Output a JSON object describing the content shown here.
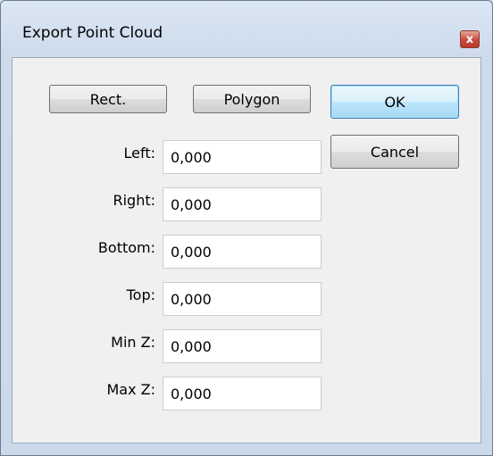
{
  "window": {
    "title": "Export Point Cloud",
    "close_symbol": "x"
  },
  "buttons": {
    "rect": "Rect.",
    "polygon": "Polygon",
    "ok": "OK",
    "cancel": "Cancel"
  },
  "fields": [
    {
      "label": "Left:",
      "value": "0,000"
    },
    {
      "label": "Right:",
      "value": "0,000"
    },
    {
      "label": "Bottom:",
      "value": "0,000"
    },
    {
      "label": "Top:",
      "value": "0,000"
    },
    {
      "label": "Min Z:",
      "value": "0,000"
    },
    {
      "label": "Max Z:",
      "value": "0,000"
    }
  ],
  "colors": {
    "frame": "#cfdcec",
    "default_button": "#bee6fd",
    "close_button": "#c8493a"
  }
}
